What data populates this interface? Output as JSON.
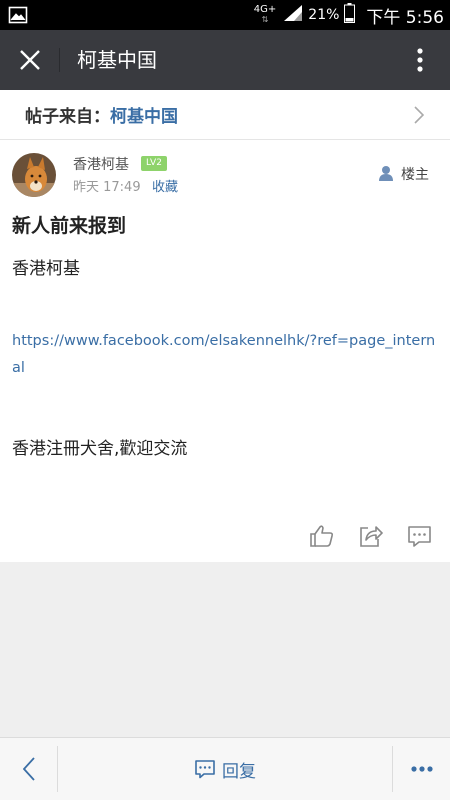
{
  "status_bar": {
    "network": "4G+",
    "battery": "21%",
    "time": "下午 5:56"
  },
  "titlebar": {
    "title": "柯基中国"
  },
  "post": {
    "source_prefix": "帖子来自：",
    "source_name": "柯基中国",
    "author": "香港柯基",
    "level": "LV2",
    "time": "昨天 17:49",
    "favorite_label": "收藏",
    "op_label": "楼主",
    "title": "新人前来报到",
    "line1": "香港柯基",
    "link": "https://www.facebook.com/elsakennelhk/?ref=page_internal",
    "line2": "香港注冊犬舍,歡迎交流"
  },
  "bottom_bar": {
    "reply_label": "回复"
  },
  "colors": {
    "titlebar_bg": "#393a3f",
    "accent_blue": "#3a6ea5",
    "level_badge": "#8ed36b"
  },
  "icons": [
    "gallery-icon",
    "signal-icon",
    "battery-icon",
    "close-icon",
    "more-vertical-icon",
    "chevron-right-icon",
    "user-icon",
    "like-icon",
    "share-icon",
    "comment-icon",
    "back-arrow-icon",
    "reply-icon",
    "more-horizontal-icon"
  ]
}
